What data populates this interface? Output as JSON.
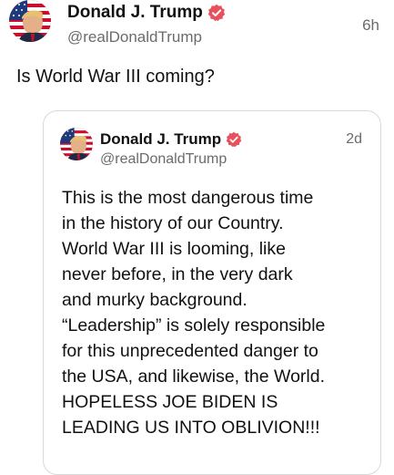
{
  "post": {
    "author": {
      "display_name": "Donald J. Trump",
      "handle": "@realDonaldTrump",
      "avatar_icon": "flag-portrait-avatar",
      "verified_icon": "verified-badge-icon",
      "verified_color": "#e8505b"
    },
    "timestamp": "6h",
    "text": "Is World War III coming?"
  },
  "quoted_post": {
    "author": {
      "display_name": "Donald J. Trump",
      "handle": "@realDonaldTrump",
      "avatar_icon": "flag-portrait-avatar",
      "verified_icon": "verified-badge-icon"
    },
    "timestamp": "2d",
    "lines": [
      "This is the most dangerous time",
      "in the history of our Country.",
      "World War III is looming, like",
      "never before, in the very dark",
      "and murky background.",
      "“Leadership” is solely responsible",
      "for this unprecedented danger to",
      "the USA, and likewise, the World.",
      "HOPELESS JOE BIDEN IS",
      "LEADING US INTO OBLIVION!!!"
    ]
  }
}
